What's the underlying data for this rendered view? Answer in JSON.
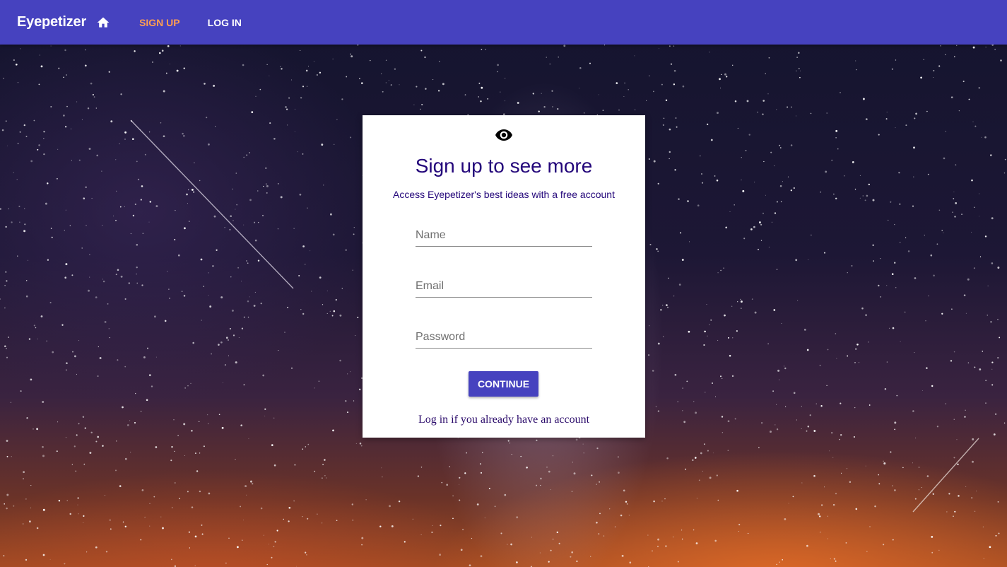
{
  "appbar": {
    "brand": "Eyepetizer",
    "nav": {
      "signup": "SIGN UP",
      "login": "LOG IN"
    },
    "colors": {
      "bar": "#4642bf",
      "active_link": "#ff9e52"
    }
  },
  "card": {
    "icon": "eye-icon",
    "title": "Sign up to see more",
    "subtitle": "Access Eyepetizer's best ideas with a free account",
    "fields": {
      "name_placeholder": "Name",
      "email_placeholder": "Email",
      "password_placeholder": "Password"
    },
    "continue_label": "CONTINUE",
    "login_link": "Log in if you already have an account"
  }
}
